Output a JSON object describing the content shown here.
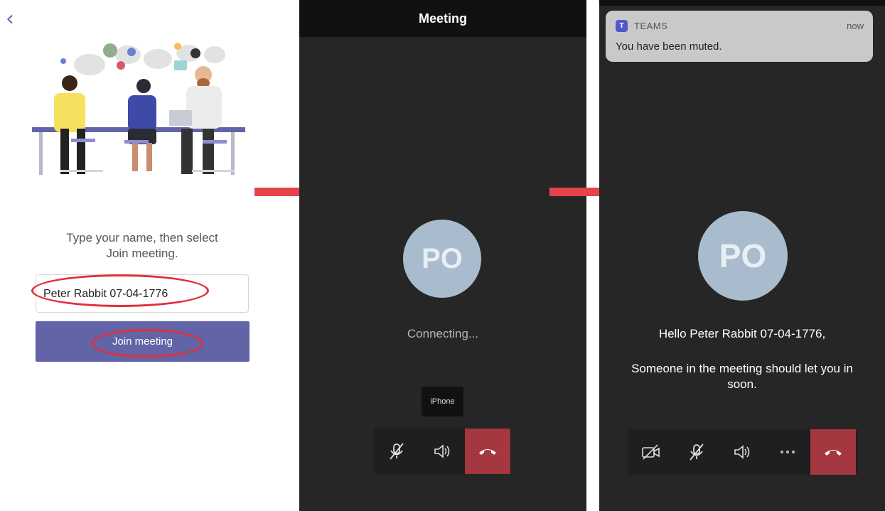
{
  "colors": {
    "brand": "#6264a7",
    "hangup": "#a4373f",
    "dark_bg": "#262626",
    "avatar": "#a8bcce",
    "annotation": "#e0303a",
    "arrow": "#e8434a"
  },
  "join_screen": {
    "back_icon": "chevron-left-icon",
    "instruction_line1": "Type your name, then select",
    "instruction_line2": "Join meeting.",
    "name_value": "Peter Rabbit 07-04-1776",
    "join_label": "Join meeting"
  },
  "connecting_screen": {
    "title": "Meeting",
    "avatar_initials": "PO",
    "status": "Connecting...",
    "device": "iPhone",
    "controls": [
      "mic-muted-icon",
      "speaker-icon",
      "hang-up-icon"
    ]
  },
  "lobby_screen": {
    "notification": {
      "app": "TEAMS",
      "time": "now",
      "message": "You have been muted."
    },
    "avatar_initials": "PO",
    "greeting": "Hello Peter Rabbit 07-04-1776,",
    "wait_message": "Someone in the meeting should let you in soon.",
    "controls": [
      "video-off-icon",
      "mic-muted-icon",
      "speaker-icon",
      "more-icon",
      "hang-up-icon"
    ]
  }
}
